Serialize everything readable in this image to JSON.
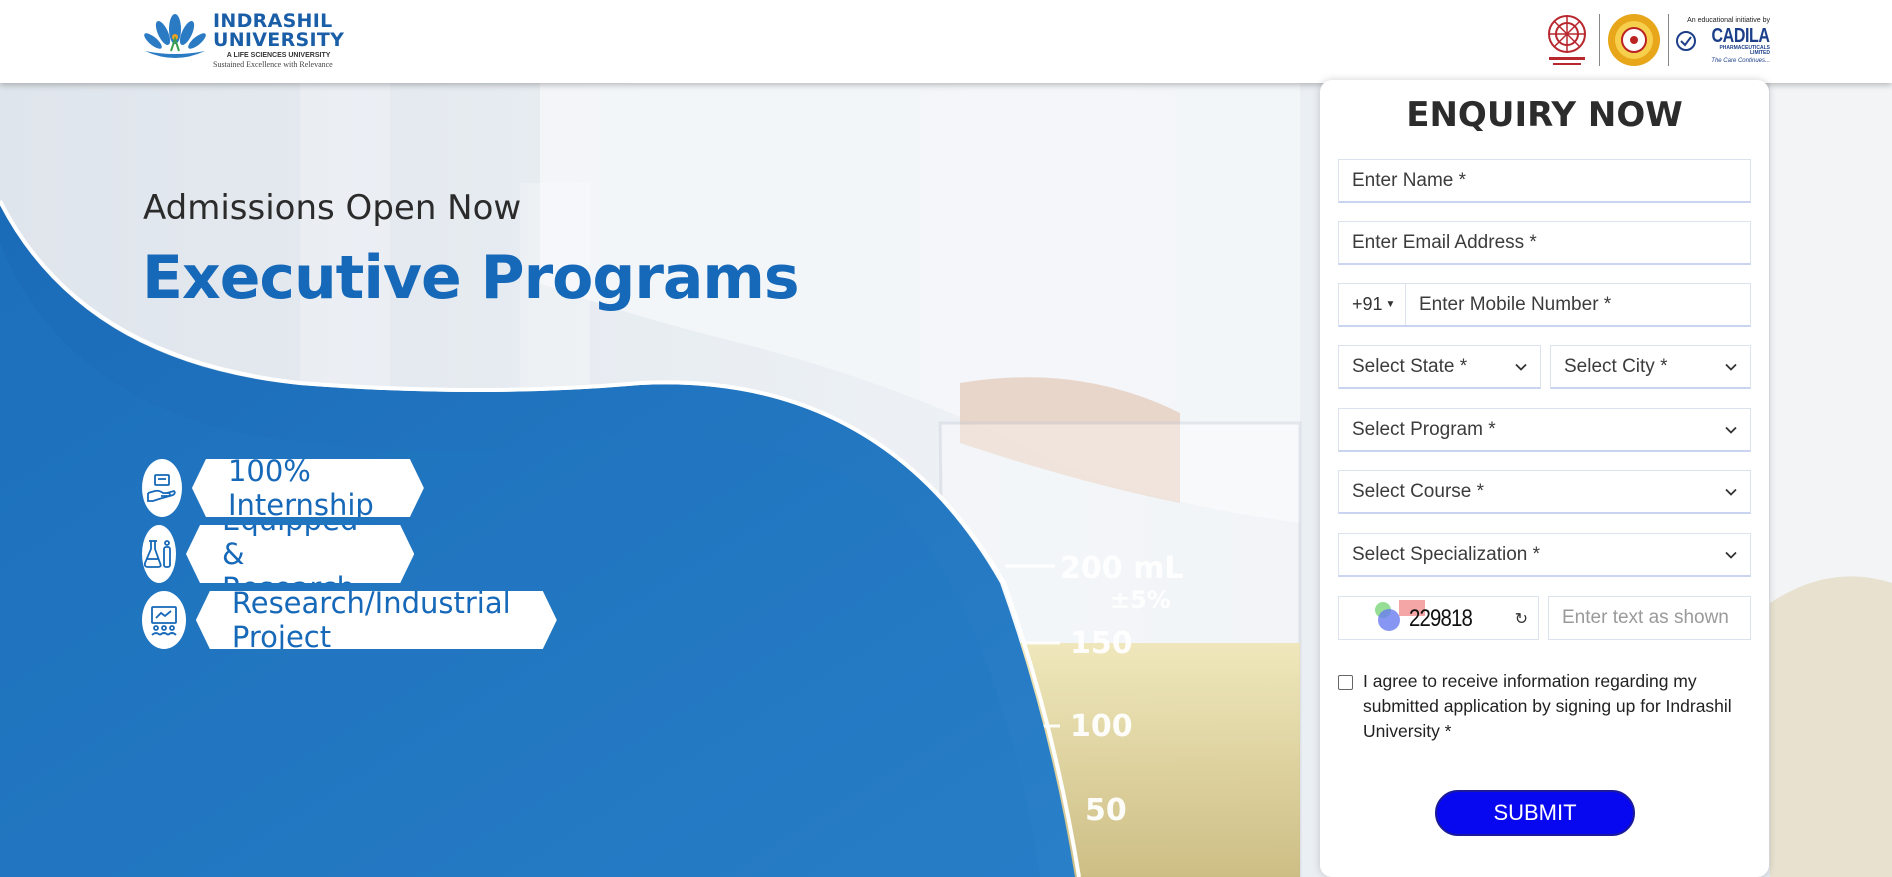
{
  "header": {
    "logo": {
      "name_line1": "INDRASHIL",
      "name_line2": "UNIVERSITY",
      "tagline": "A LIFE SCIENCES UNIVERSITY",
      "subline": "Sustained Excellence with Relevance"
    },
    "partners": {
      "cadila_top": "An educational initiative by",
      "cadila_name": "CADILA",
      "cadila_sub": "PHARMACEUTICALS",
      "cadila_limited": "LIMITED",
      "cadila_tagline": "The Care Continues..."
    }
  },
  "hero": {
    "kicker": "Admissions Open Now",
    "headline": "Executive Programs",
    "features": [
      {
        "label": "100% Internship",
        "icon": "internship-hand-icon"
      },
      {
        "label": "Highly Equipped & Research Lab",
        "icon": "lab-flask-icon"
      },
      {
        "label": "Research/Industrial Project",
        "icon": "presentation-board-icon"
      }
    ],
    "colors": {
      "brand_blue": "#1668b8",
      "wave_blue": "#1f74c0"
    }
  },
  "form": {
    "title": "ENQUIRY NOW",
    "name_placeholder": "Enter Name *",
    "email_placeholder": "Enter Email Address *",
    "country_code": "+91",
    "mobile_placeholder": "Enter Mobile Number *",
    "state_placeholder": "Select State *",
    "city_placeholder": "Select City *",
    "program_placeholder": "Select Program *",
    "course_placeholder": "Select Course *",
    "specialization_placeholder": "Select Specialization *",
    "captcha_code": "229818",
    "captcha_input_placeholder": "Enter text as shown",
    "consent_text": "I agree to receive information regarding my submitted application by signing up for Indrashil University *",
    "submit_label": "SUBMIT",
    "submit_color": "#0808f0"
  }
}
